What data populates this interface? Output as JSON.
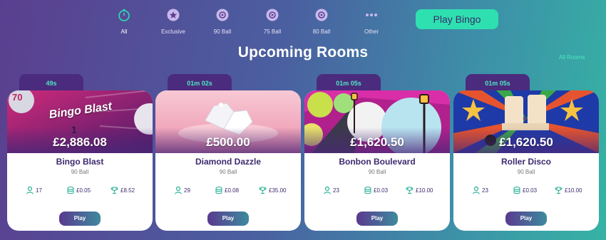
{
  "nav": {
    "items": [
      {
        "label": "All",
        "icon": "stopwatch-icon",
        "active": true
      },
      {
        "label": "Exclusive",
        "icon": "star-icon",
        "active": false
      },
      {
        "label": "90 Ball",
        "icon": "bingo-ball-icon",
        "active": false
      },
      {
        "label": "75 Ball",
        "icon": "bingo-ball-icon",
        "active": false
      },
      {
        "label": "80 Ball",
        "icon": "bingo-ball-icon",
        "active": false
      },
      {
        "label": "Other",
        "icon": "more-dots-icon",
        "active": false
      }
    ],
    "play_bingo_label": "Play Bingo"
  },
  "section": {
    "title": "Upcoming Rooms",
    "all_rooms_label": "All Rooms"
  },
  "rooms": [
    {
      "timer": "49s",
      "jackpot": "£2,886.08",
      "name": "Bingo Blast",
      "type": "90 Ball",
      "players": "17",
      "ticket_price": "£0.05",
      "prize": "£8.52",
      "play_label": "Play",
      "logo_text": "Bingo Blast",
      "ball_number": "70"
    },
    {
      "timer": "01m 02s",
      "jackpot": "£500.00",
      "name": "Diamond Dazzle",
      "type": "90 Ball",
      "players": "29",
      "ticket_price": "£0.08",
      "prize": "£35.00",
      "play_label": "Play"
    },
    {
      "timer": "01m 05s",
      "jackpot": "£1,620.50",
      "name": "Bonbon Boulevard",
      "type": "90 Ball",
      "players": "23",
      "ticket_price": "£0.03",
      "prize": "£10.00",
      "play_label": "Play"
    },
    {
      "timer": "01m 05s",
      "jackpot": "£1,620.50",
      "name": "Roller Disco",
      "type": "90 Ball",
      "players": "23",
      "ticket_price": "£0.03",
      "prize": "£10.00",
      "play_label": "Play"
    }
  ],
  "colors": {
    "accent": "#2ee0b0",
    "timer_text": "#4ee6c2",
    "timer_bg": "#4b2b7d",
    "room_text": "#3d2a6e"
  }
}
